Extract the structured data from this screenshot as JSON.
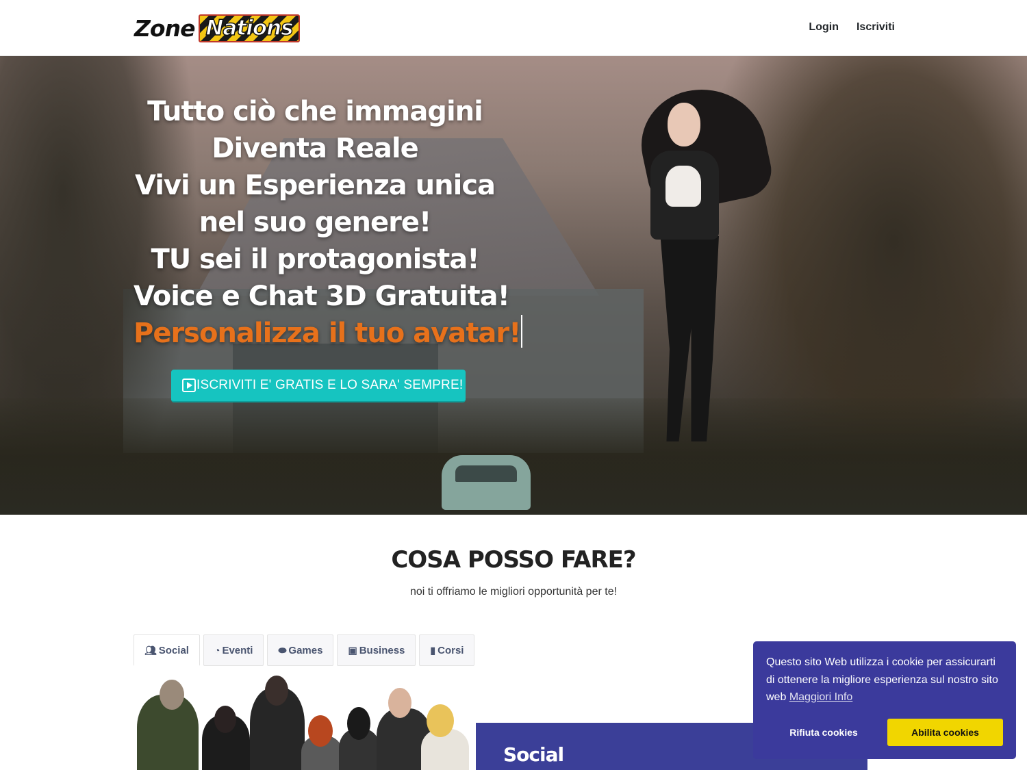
{
  "header": {
    "logo": {
      "part1": "Zone",
      "part2": "Nations"
    },
    "nav": {
      "login": "Login",
      "signup": "Iscriviti"
    }
  },
  "hero": {
    "lines": [
      "Tutto ciò che immagini",
      "Diventa Reale",
      "Vivi un Esperienza unica",
      "nel suo genere!",
      "TU sei il protagonista!",
      "Voice e Chat 3D Gratuita!"
    ],
    "accent_line": "Personalizza il tuo avatar!",
    "cta": "ISCRIVITI E' GRATIS E LO SARA' SEMPRE!"
  },
  "features": {
    "title": "COSA POSSO FARE?",
    "subtitle": "noi ti offriamo le migliori opportunità per te!",
    "tabs": [
      {
        "label": "Social",
        "icon": "users-icon"
      },
      {
        "label": "Eventi",
        "icon": "dashboard-icon"
      },
      {
        "label": "Games",
        "icon": "gamepad-icon"
      },
      {
        "label": "Business",
        "icon": "briefcase-icon"
      },
      {
        "label": "Corsi",
        "icon": "book-icon"
      }
    ],
    "panel_title": "Social"
  },
  "cookie": {
    "message": "Questo sito Web utilizza i cookie per assicurarti di ottenere la migliore esperienza sul nostro sito web",
    "more_info": "Maggiori Info",
    "deny": "Rifiuta cookies",
    "allow": "Abilita cookies"
  },
  "colors": {
    "accent_orange": "#e7711b",
    "cta_teal": "#16c4c0",
    "panel_indigo": "#3b3f98",
    "cookie_bg": "#3b3a9c",
    "cookie_allow": "#f1d600"
  }
}
